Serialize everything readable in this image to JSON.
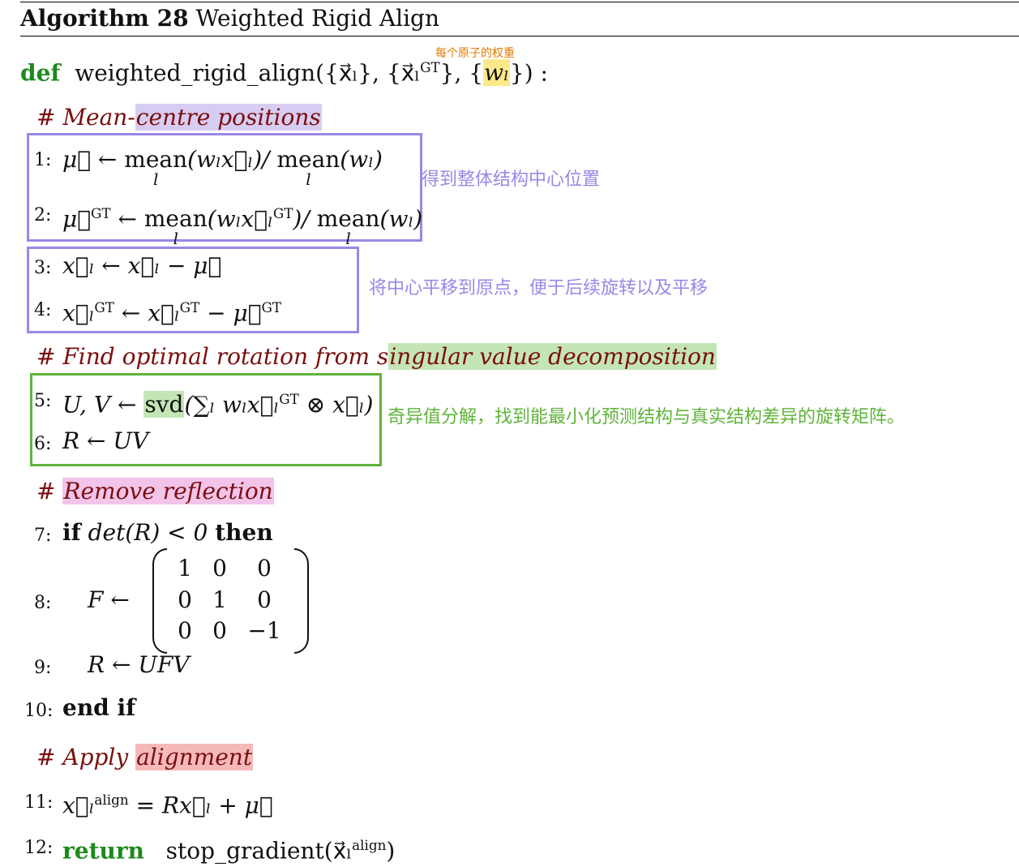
{
  "algo": {
    "label": "Algorithm 28",
    "name": "Weighted Rigid Align"
  },
  "def": {
    "keyword": "def",
    "name": "weighted_rigid_align",
    "args": "({x⃗ₗ}, {x⃗ₗ",
    "args_gt": "GT",
    "args_rest": "}, {",
    "weight": "wₗ",
    "close": "}) :",
    "note": "每个原子的权重"
  },
  "comments": {
    "c1_pre": "# Mean-",
    "c1_hl": "centre positions",
    "c2_pre": "# Find optimal rotation from s",
    "c2_hl": "ingular value decomposition",
    "c3_pre": "# ",
    "c3_hl": "Remove reflection",
    "c4_pre": "# Apply ",
    "c4_hl": "alignment"
  },
  "lines": {
    "n1": "1:",
    "n2": "2:",
    "n3": "3:",
    "n4": "4:",
    "n5": "5:",
    "n6": "6:",
    "n7": "7:",
    "n8": "8:",
    "n9": "9:",
    "n10": "10:",
    "n11": "11:",
    "n12": "12:",
    "l1_a": "μ⃗ ← ",
    "l1_mean1": "mean",
    "l1_b": "(wₗx⃗ₗ)/ ",
    "l1_mean2": "mean",
    "l1_c": "(wₗ)",
    "under_l": "l",
    "l2_a": "μ⃗",
    "l2_sup": "GT",
    "l2_b": " ← ",
    "l2_mean1": "mean",
    "l2_c": "(wₗx⃗ₗ",
    "l2_sup2": "GT",
    "l2_d": ")/ ",
    "l2_mean2": "mean",
    "l2_e": "(wₗ)",
    "l3": "x⃗ₗ ← x⃗ₗ − μ⃗",
    "l4_a": "x⃗ₗ",
    "l4_sup": "GT",
    "l4_b": " ← x⃗ₗ",
    "l4_sup2": "GT",
    "l4_c": " − μ⃗",
    "l4_sup3": "GT",
    "l5_a": "U, V ← ",
    "l5_svd": "svd",
    "l5_b": "(∑ₗ wₗx⃗ₗ",
    "l5_sup": "GT",
    "l5_c": " ⊗ x⃗ₗ)",
    "l6": "R ← UV",
    "l7_if": "if",
    "l7_mid": " det(R) < 0 ",
    "l7_then": "then",
    "l8": "F ←",
    "l9": "R ← UFV",
    "l10": "end if",
    "l11_a": "x⃗ₗ",
    "l11_sup": "align",
    "l11_b": " = Rx⃗ₗ + μ⃗",
    "l12_ret": "return",
    "l12_a": "stop_gradient(x⃗ₗ",
    "l12_sup": "align",
    "l12_b": ")"
  },
  "matrix": {
    "r1": [
      "1",
      "0",
      "0"
    ],
    "r2": [
      "0",
      "1",
      "0"
    ],
    "r3": [
      "0",
      "0",
      "−1"
    ]
  },
  "annotations": {
    "a1": "得到整体结构中心位置",
    "a2": "将中心平移到原点，便于后续旋转以及平移",
    "a3": "奇异值分解，找到能最小化预测结构与真实结构差异的旋转矩阵。"
  },
  "colors": {
    "purple": "#9b87e6",
    "green": "#5fb33a",
    "orange": "#e07b00",
    "highlight_yellow": "#fde98a",
    "highlight_purple": "#d7cdf2",
    "highlight_green": "#c4e5b5",
    "highlight_pink": "#f3c4ea",
    "highlight_red": "#f6b9b9",
    "comment": "#7a0f0f",
    "keyword_green": "#1d8a1d"
  }
}
